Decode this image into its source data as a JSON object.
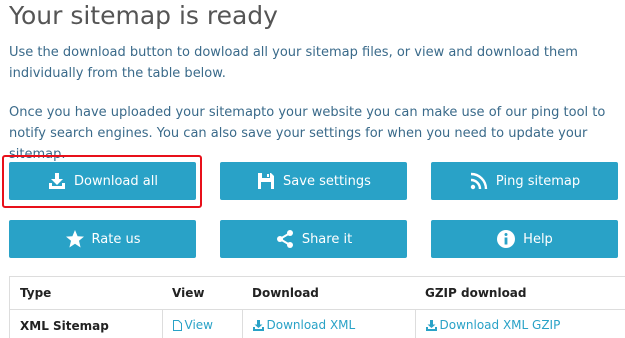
{
  "page": {
    "title": "Your sitemap is ready",
    "intro": "Use the download button to dowload all your sitemap files, or view and download them individually from the table below.",
    "ping_info": "Once you have uploaded your sitemapto your website you can make use of our ping tool to notify search engines. You can also save your settings for when you need to update your sitemap."
  },
  "buttons": {
    "download_all": "Download all",
    "save_settings": "Save settings",
    "ping_sitemap": "Ping sitemap",
    "rate_us": "Rate us",
    "share_it": "Share it",
    "help": "Help"
  },
  "icons": {
    "download_all": "download-icon",
    "save_settings": "save-icon",
    "ping_sitemap": "rss-icon",
    "rate_us": "star-icon",
    "share_it": "share-icon",
    "help": "info-icon"
  },
  "table": {
    "headers": [
      "Type",
      "View",
      "Download",
      "GZIP download"
    ],
    "rows": [
      {
        "type": "XML Sitemap",
        "view": "View",
        "download": "Download XML",
        "gzip": "Download XML GZIP"
      }
    ]
  },
  "colors": {
    "button": "#29a2c7",
    "highlight": "#e8101a",
    "text": "#3a6a8a",
    "title": "#555555"
  }
}
